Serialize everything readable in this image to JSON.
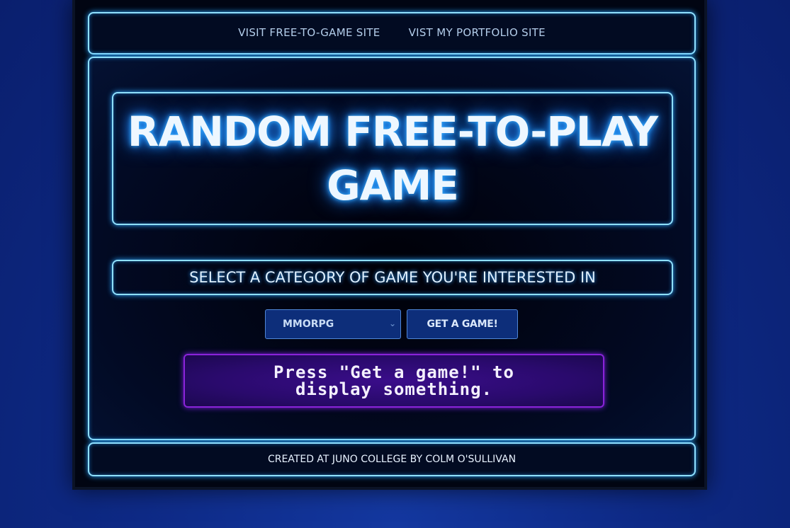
{
  "nav": {
    "links": [
      {
        "label": "VISIT FREE-TO-GAME SITE"
      },
      {
        "label": "VIST MY PORTFOLIO SITE"
      }
    ]
  },
  "header": {
    "title_line1": "RANDOM FREE-TO-PLAY",
    "title_line2": "GAME"
  },
  "category": {
    "heading": "SELECT A CATEGORY OF GAME YOU'RE INTERESTED IN",
    "selected": "MMORPG",
    "button_label": "GET A GAME!"
  },
  "output": {
    "line1": "Press \"Get a game!\" to",
    "line2": "display something."
  },
  "footer": {
    "credit": "CREATED AT JUNO COLLEGE BY COLM O'SULLIVAN"
  },
  "colors": {
    "neon_blue": "#8fe0ff",
    "glow": "#2aa5ff",
    "output_purple": "#8a23d9",
    "button_bg": "#0d2e7a"
  },
  "icons": {
    "select_arrow": "chevron-down-icon"
  }
}
